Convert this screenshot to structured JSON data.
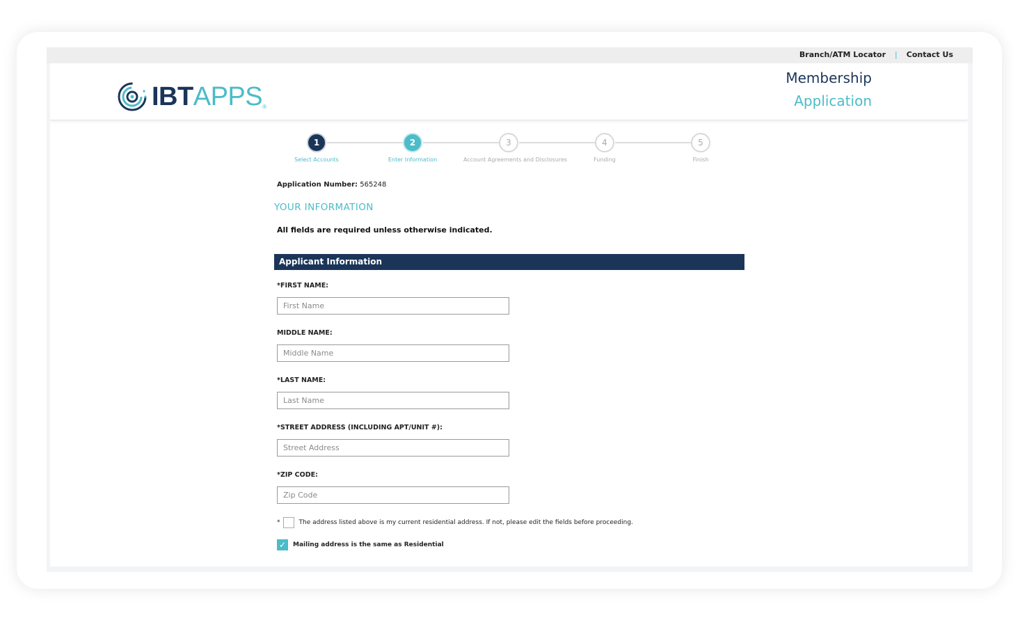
{
  "topbar": {
    "branch_link": "Branch/ATM Locator",
    "separator": "|",
    "contact_link": "Contact Us"
  },
  "header": {
    "logo_brand_bold": "IBT",
    "logo_brand_light": "APPS",
    "logo_reg": "®",
    "title_line1": "Membership",
    "title_line2": "Application"
  },
  "steps": [
    {
      "number": "1",
      "label": "Select Accounts",
      "state": "done"
    },
    {
      "number": "2",
      "label": "Enter Information",
      "state": "active"
    },
    {
      "number": "3",
      "label": "Account Agreements and Disclosures",
      "state": "pending"
    },
    {
      "number": "4",
      "label": "Funding",
      "state": "pending"
    },
    {
      "number": "5",
      "label": "Finish",
      "state": "pending"
    }
  ],
  "application": {
    "number_label": "Application Number:",
    "number_value": "565248"
  },
  "section_title": "YOUR INFORMATION",
  "required_note": "All fields are required unless otherwise indicated.",
  "applicant_bar": "Applicant Information",
  "fields": {
    "first_name": {
      "label": "*FIRST NAME:",
      "placeholder": "First Name",
      "value": ""
    },
    "middle_name": {
      "label": "MIDDLE NAME:",
      "placeholder": "Middle Name",
      "value": ""
    },
    "last_name": {
      "label": "*LAST NAME:",
      "placeholder": "Last Name",
      "value": ""
    },
    "street": {
      "label": "*STREET ADDRESS (INCLUDING APT/UNIT #):",
      "placeholder": "Street Address",
      "value": ""
    },
    "zip": {
      "label": "*ZIP CODE:",
      "placeholder": "Zip Code",
      "value": ""
    }
  },
  "checks": {
    "residential_asterisk": "*",
    "residential_text": "The address listed above is my current residential address. If not, please edit the fields before proceeding.",
    "residential_checked": false,
    "mailing_text": "Mailing address is the same as Residential",
    "mailing_checked": true,
    "mailing_checkmark": "✓"
  },
  "colors": {
    "navy": "#1b3559",
    "teal": "#4bbcc8"
  }
}
